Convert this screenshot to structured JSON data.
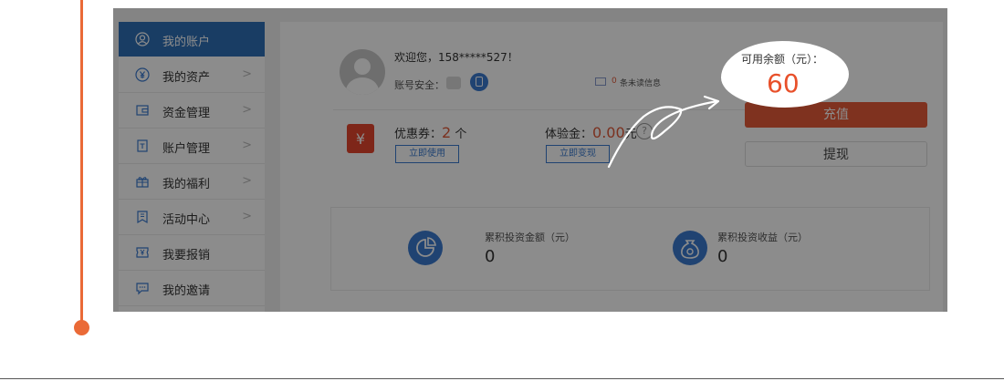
{
  "sidebar": {
    "items": [
      {
        "label": "我的账户",
        "icon": "user-circle-icon",
        "active": true
      },
      {
        "label": "我的资产",
        "icon": "yen-circle-icon",
        "chevron": ">"
      },
      {
        "label": "资金管理",
        "icon": "wallet-icon",
        "chevron": ">"
      },
      {
        "label": "账户管理",
        "icon": "account-card-icon",
        "chevron": ">"
      },
      {
        "label": "我的福利",
        "icon": "gift-icon",
        "chevron": ">"
      },
      {
        "label": "活动中心",
        "icon": "bookmark-icon",
        "chevron": ">"
      },
      {
        "label": "我要报销",
        "icon": "yen-ticket-icon"
      },
      {
        "label": "我的邀请",
        "icon": "chat-bubble-icon"
      }
    ]
  },
  "user": {
    "welcome": "欢迎您，158*****527！",
    "security_label": "账号安全："
  },
  "messages": {
    "count": "0",
    "text": "条未读信息"
  },
  "coupon": {
    "label": "优惠券：",
    "count": "2",
    "unit": " 个",
    "action": "立即使用"
  },
  "experience": {
    "label": "体验金：",
    "value": "0.00",
    "unit": "元",
    "action": "立即变现",
    "help": "?"
  },
  "balance": {
    "label": "可用余额（元）：",
    "value": "60"
  },
  "actions": {
    "recharge": "充值",
    "withdraw": "提现"
  },
  "stats": {
    "invest_total_label": "累积投资金额（元）",
    "invest_total_value": "0",
    "invest_profit_label": "累积投资收益（元）",
    "invest_profit_value": "0"
  },
  "colors": {
    "accent_orange": "#ea6a37",
    "primary_blue": "#2f6fb6",
    "value_red": "#e8502a"
  }
}
